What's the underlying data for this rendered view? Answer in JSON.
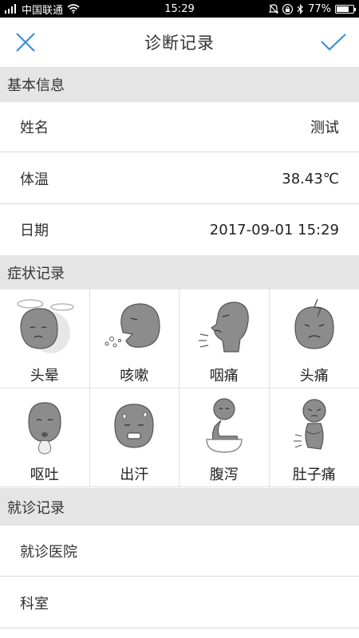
{
  "status_bar": {
    "carrier": "中国联通",
    "time": "15:29",
    "battery": "77%",
    "battery_level": 0.77
  },
  "header": {
    "title": "诊断记录"
  },
  "colors": {
    "accent": "#3a8fd8",
    "section_bg": "#e5e5e5",
    "icon_gray": "#8c8c8c"
  },
  "basic_info": {
    "section_title": "基本信息",
    "name_label": "姓名",
    "name_value": "测试",
    "temp_label": "体温",
    "temp_value": "38.43℃",
    "date_label": "日期",
    "date_value": "2017-09-01 15:29"
  },
  "symptoms": {
    "section_title": "症状记录",
    "items": [
      {
        "label": "头晕",
        "icon": "dizzy-icon"
      },
      {
        "label": "咳嗽",
        "icon": "cough-icon"
      },
      {
        "label": "咽痛",
        "icon": "sore-throat-icon"
      },
      {
        "label": "头痛",
        "icon": "headache-icon"
      },
      {
        "label": "呕吐",
        "icon": "vomit-icon"
      },
      {
        "label": "出汗",
        "icon": "sweat-icon"
      },
      {
        "label": "腹泻",
        "icon": "diarrhea-icon"
      },
      {
        "label": "肚子痛",
        "icon": "stomachache-icon"
      }
    ]
  },
  "visit": {
    "section_title": "就诊记录",
    "hospital_label": "就诊医院",
    "department_label": "科室"
  }
}
